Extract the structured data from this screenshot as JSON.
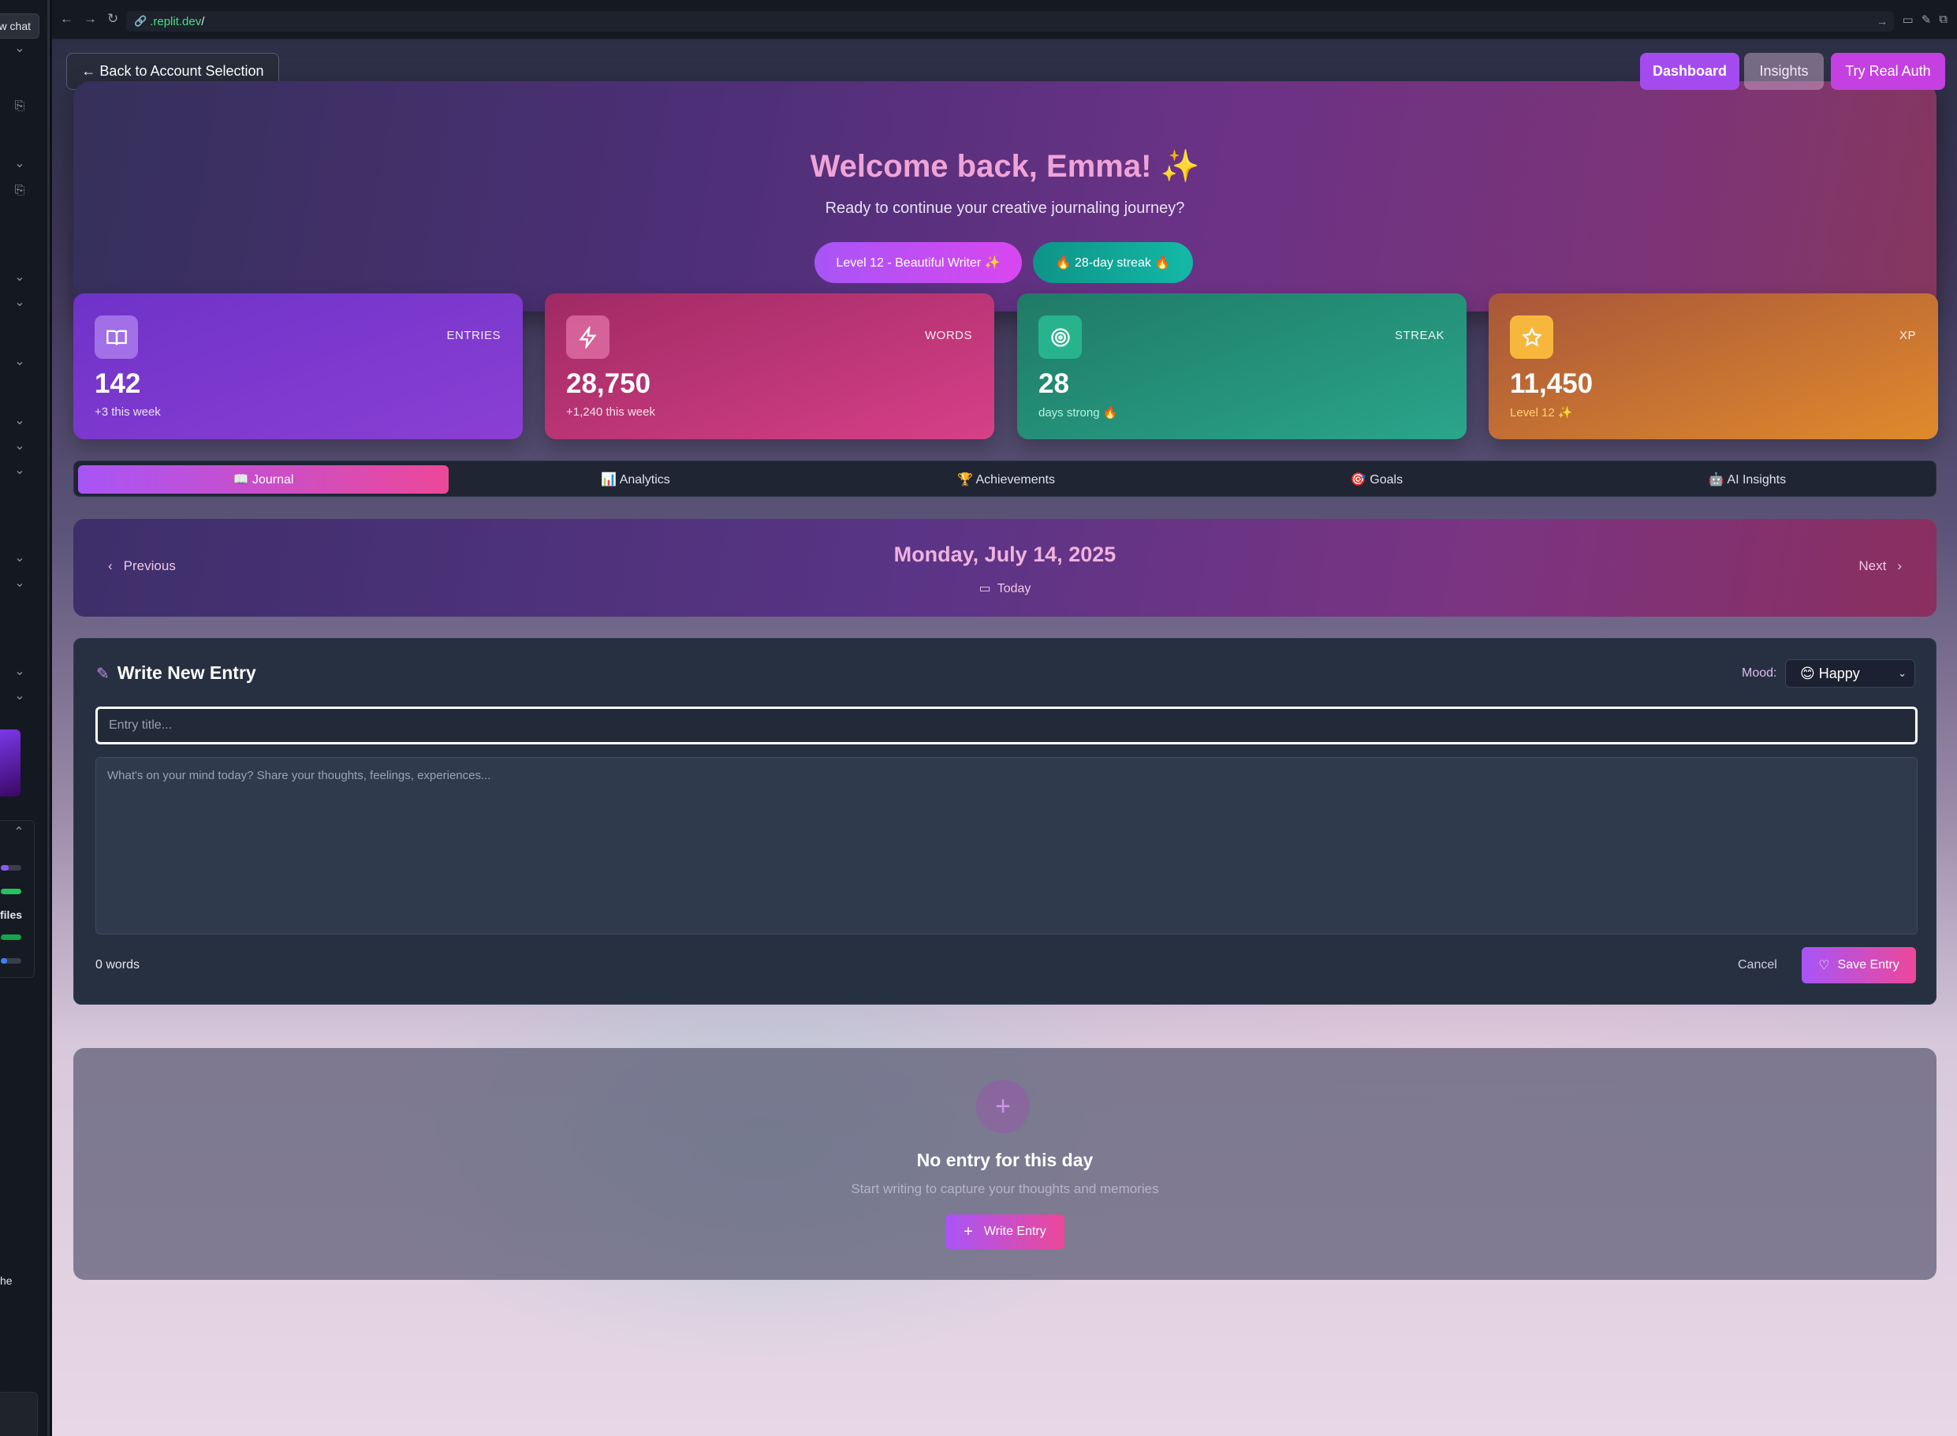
{
  "ide": {
    "new_chat_label": "w chat",
    "files_label": "files",
    "cut_text": "he"
  },
  "browser": {
    "url_host": ".replit.dev",
    "url_path": "/"
  },
  "header": {
    "back_label": "← Back to Account Selection",
    "dashboard_label": "Dashboard",
    "insights_label": "Insights",
    "real_auth_label": "Try Real Auth"
  },
  "hero": {
    "title": "Welcome back, Emma! ✨",
    "subtitle": "Ready to continue your creative journaling journey?",
    "level_pill": "Level 12 - Beautiful Writer ✨",
    "streak_pill": "🔥 28-day streak 🔥"
  },
  "stats": [
    {
      "label": "ENTRIES",
      "value": "142",
      "sub": "+3 this week",
      "icon": "book-icon"
    },
    {
      "label": "WORDS",
      "value": "28,750",
      "sub": "+1,240 this week",
      "icon": "lightning-icon"
    },
    {
      "label": "STREAK",
      "value": "28",
      "sub": "days strong 🔥",
      "icon": "target-icon"
    },
    {
      "label": "XP",
      "value": "11,450",
      "sub": "Level 12 ✨",
      "icon": "star-icon"
    }
  ],
  "tabs": [
    {
      "label": "📖 Journal",
      "active": true
    },
    {
      "label": "📊 Analytics",
      "active": false
    },
    {
      "label": "🏆 Achievements",
      "active": false
    },
    {
      "label": "🎯 Goals",
      "active": false
    },
    {
      "label": "🤖 AI Insights",
      "active": false
    }
  ],
  "date_nav": {
    "previous_label": "Previous",
    "next_label": "Next",
    "date": "Monday, July 14, 2025",
    "today_label": "Today"
  },
  "entry": {
    "heading": "Write New Entry",
    "mood_label": "Mood:",
    "mood_value": "😊 Happy",
    "title_placeholder": "Entry title...",
    "body_placeholder": "What's on your mind today? Share your thoughts, feelings, experiences...",
    "word_count": "0 words",
    "cancel_label": "Cancel",
    "save_label": "Save Entry"
  },
  "empty_state": {
    "title": "No entry for this day",
    "subtitle": "Start writing to capture your thoughts and memories",
    "write_label": "Write Entry"
  },
  "colors": {
    "accent_purple": "#a855f7",
    "accent_pink": "#ec4899",
    "streak_teal": "#14b8a6"
  }
}
